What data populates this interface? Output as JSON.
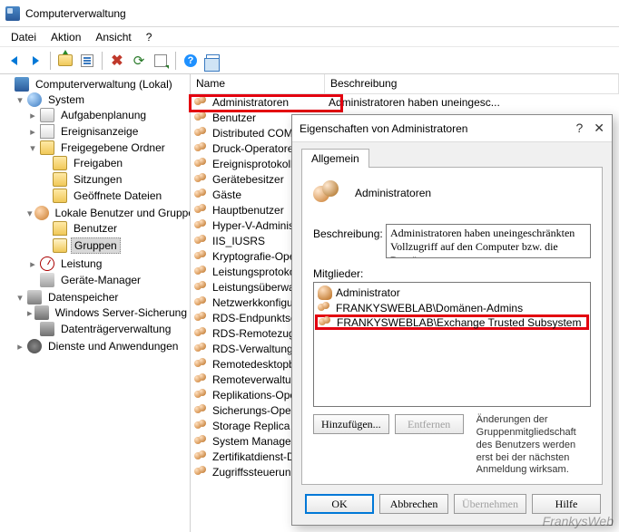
{
  "title": "Computerverwaltung",
  "menu": {
    "file": "Datei",
    "action": "Aktion",
    "view": "Ansicht",
    "help": "?"
  },
  "tree": {
    "root": "Computerverwaltung (Lokal)",
    "system": "System",
    "task_scheduler": "Aufgabenplanung",
    "event_viewer": "Ereignisanzeige",
    "shared_folders": "Freigegebene Ordner",
    "shares": "Freigaben",
    "sessions": "Sitzungen",
    "open_files": "Geöffnete Dateien",
    "local_users": "Lokale Benutzer und Gruppen",
    "users": "Benutzer",
    "groups": "Gruppen",
    "performance": "Leistung",
    "device_manager": "Geräte-Manager",
    "storage": "Datenspeicher",
    "server_backup": "Windows Server-Sicherung",
    "disk_mgmt": "Datenträgerverwaltung",
    "services_apps": "Dienste und Anwendungen"
  },
  "list": {
    "col_name": "Name",
    "col_desc": "Beschreibung",
    "first_desc": "Administratoren haben uneingesc...",
    "groups": [
      "Administratoren",
      "Benutzer",
      "Distributed COM-Benutzer",
      "Druck-Operatoren",
      "Ereignisprotokollleser",
      "Gerätebesitzer",
      "Gäste",
      "Hauptbenutzer",
      "Hyper-V-Administratoren",
      "IIS_IUSRS",
      "Kryptografie-Operatoren",
      "Leistungsprotokollbenutzer",
      "Leistungsüberwachungsbenutzer",
      "Netzwerkkonfigurations-Operatoren",
      "RDS-Endpunktserver",
      "RDS-Remotezugriffsserver",
      "RDS-Verwaltungsserver",
      "Remotedesktopbenutzer",
      "Remoteverwaltungsbenutzer",
      "Replikations-Operator",
      "Sicherungs-Operatoren",
      "Storage Replica Administrators",
      "System Managed Accounts Group",
      "Zertifikatdienst-DCOM-Zugriff",
      "Zugriffssteuerungsunterstützungs-Operatoren"
    ]
  },
  "dialog": {
    "title": "Eigenschaften von Administratoren",
    "help": "?",
    "tab_general": "Allgemein",
    "group_name": "Administratoren",
    "desc_label": "Beschreibung:",
    "desc_value": "Administratoren haben uneingeschränkten Vollzugriff auf den Computer bzw. die Domäne.",
    "members_label": "Mitglieder:",
    "members": [
      {
        "type": "user",
        "name": "Administrator"
      },
      {
        "type": "group",
        "name": "FRANKYSWEBLAB\\Domänen-Admins"
      },
      {
        "type": "group",
        "name": "FRANKYSWEBLAB\\Exchange Trusted Subsystem"
      }
    ],
    "add": "Hinzufügen...",
    "remove": "Entfernen",
    "note": "Änderungen der Gruppenmitgliedschaft des Benutzers werden erst bei der nächsten Anmeldung wirksam.",
    "ok": "OK",
    "cancel": "Abbrechen",
    "apply": "Übernehmen",
    "help_btn": "Hilfe"
  },
  "watermark": "FrankysWeb"
}
